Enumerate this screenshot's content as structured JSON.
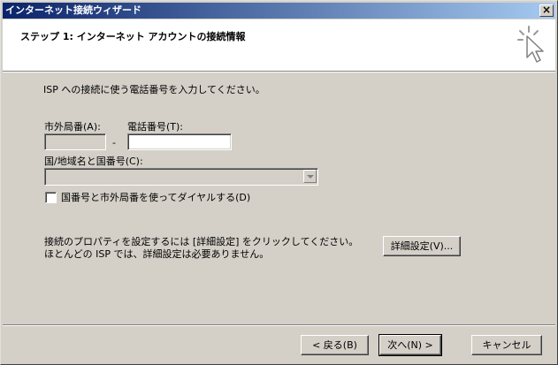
{
  "window": {
    "title": "インターネット接続ウィザード",
    "close_glyph": "×"
  },
  "header": {
    "title": "ステップ 1: インターネット アカウントの接続情報"
  },
  "body": {
    "instruction": "ISP への接続に使う電話番号を入力してください。",
    "area_code_label": "市外局番(A):",
    "area_code_value": "",
    "dash": "-",
    "phone_label": "電話番号(T):",
    "phone_value": "",
    "country_label": "国/地域名と国番号(C):",
    "country_value": "",
    "checkbox_label": "国番号と市外局番を使ってダイヤルする(D)",
    "checkbox_checked": false,
    "props_line1": "接続のプロパティを設定するには [詳細設定] をクリックしてください。",
    "props_line2": "ほとんどの ISP では、詳細設定は必要ありません。",
    "advanced_button": "詳細設定(V)..."
  },
  "footer": {
    "back_button": "< 戻る(B)",
    "next_button": "次へ(N) >",
    "cancel_button": "キャンセル"
  },
  "icons": {
    "header_icon": "cursor-sparkle-icon",
    "dropdown": "chevron-down-icon"
  },
  "colors": {
    "title_gradient_start": "#0a246a",
    "title_gradient_end": "#a6caf0",
    "face": "#d4d0c8"
  }
}
